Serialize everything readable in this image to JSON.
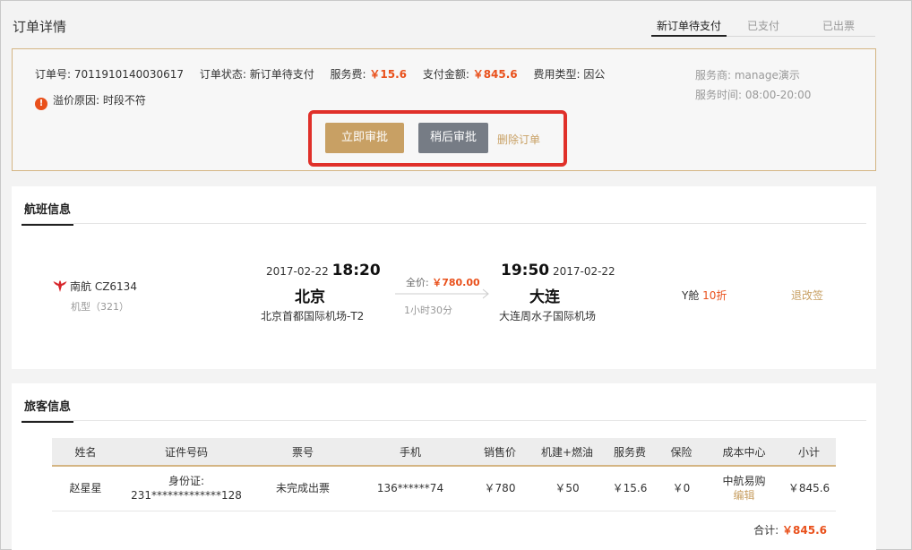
{
  "header": {
    "title": "订单详情",
    "steps": [
      "新订单待支付",
      "已支付",
      "已出票"
    ]
  },
  "order": {
    "number_label": "订单号: ",
    "number": "7011910140030617",
    "status_label": "订单状态: ",
    "status": "新订单待支付",
    "service_fee_label": "服务费: ",
    "service_fee": "￥15.6",
    "payment_label": "支付金额: ",
    "payment": "￥845.6",
    "fee_type_label": "费用类型: ",
    "fee_type": "因公",
    "premium_reason": "溢价原因: 时段不符",
    "provider": "服务商: manage演示",
    "service_hours": "服务时间: 08:00-20:00",
    "approve_label": "立即审批",
    "later_label": "稍后审批",
    "delete_label": "删除订单"
  },
  "flight": {
    "section_title": "航班信息",
    "airline": "南航 CZ6134",
    "aircraft": "机型（321）",
    "dep_date": "2017-02-22",
    "dep_time": "18:20",
    "dep_city": "北京",
    "dep_airport": "北京首都国际机场-T2",
    "full_price_label": "全价: ",
    "full_price": "￥780.00",
    "duration": "1小时30分",
    "arr_time": "19:50",
    "arr_date": "2017-02-22",
    "arr_city": "大连",
    "arr_airport": "大连周水子国际机场",
    "cabin": "Y舱 ",
    "discount": "10折",
    "rebook": "退改签"
  },
  "passengers": {
    "section_title": "旅客信息",
    "columns": [
      "姓名",
      "证件号码",
      "票号",
      "手机",
      "销售价",
      "机建+燃油",
      "服务费",
      "保险",
      "成本中心",
      "小计"
    ],
    "rows": [
      {
        "name": "赵星星",
        "id_type": "身份证:",
        "id_number": "231*************128",
        "ticket": "未完成出票",
        "phone": "136******74",
        "price": "￥780",
        "tax": "￥50",
        "fee": "￥15.6",
        "insurance": "￥0",
        "cost_center": "中航易购",
        "edit": "编辑",
        "subtotal": "￥845.6"
      }
    ],
    "total_label": "合计: ",
    "total": "￥845.6"
  },
  "colors": {
    "accent_gold": "#c8a064",
    "price_red": "#e9501b",
    "highlight_red": "#e0302a",
    "button_gray": "#767c85"
  }
}
